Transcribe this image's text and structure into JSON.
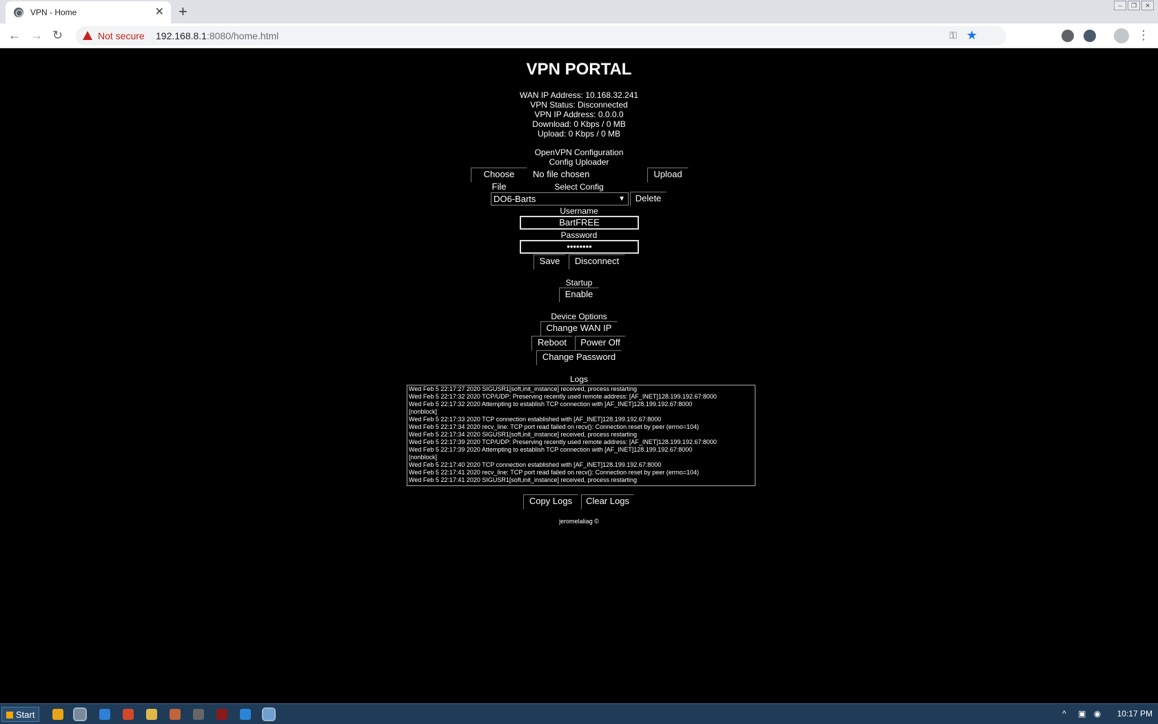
{
  "browser": {
    "tab_title": "VPN - Home",
    "tab_close": "✕",
    "new_tab": "+",
    "security_label": "Not secure",
    "url_host": "192.168.8.1",
    "url_path": ":8080/home.html",
    "back": "←",
    "forward": "→",
    "reload": "↻",
    "menu": "⋮"
  },
  "page": {
    "title": "VPN PORTAL",
    "status_lines": [
      "WAN IP Address: 10.168.32.241",
      "VPN Status: Disconnected",
      "VPN IP Address: 0.0.0.0",
      "Download: 0 Kbps / 0 MB",
      "Upload: 0 Kbps / 0 MB"
    ],
    "openvpn_heading": "OpenVPN Configuration",
    "uploader_heading": "Config Uploader",
    "choose_file_label": "Choose File",
    "no_file_text": "No file chosen",
    "upload_label": "Upload",
    "select_config_heading": "Select Config",
    "selected_config": "DO6-Barts",
    "delete_label": "Delete",
    "username_heading": "Username",
    "username_value": "BartFREE",
    "password_heading": "Password",
    "password_value": "••••••••",
    "save_label": "Save",
    "disconnect_label": "Disconnect",
    "startup_heading": "Startup",
    "enable_label": "Enable",
    "device_heading": "Device Options",
    "change_wan_label": "Change WAN IP",
    "reboot_label": "Reboot",
    "poweroff_label": "Power Off",
    "change_password_label": "Change Password",
    "logs_heading": "Logs",
    "log_lines": [
      "Wed Feb  5 22:17:27 2020 SIGUSR1[soft,init_instance] received, process restarting",
      "Wed Feb  5 22:17:32 2020 TCP/UDP: Preserving recently used remote address: [AF_INET]128.199.192.67:8000",
      "Wed Feb  5 22:17:32 2020 Attempting to establish TCP connection with [AF_INET]128.199.192.67:8000",
      "[nonblock]",
      "Wed Feb  5 22:17:33 2020 TCP connection established with [AF_INET]128.199.192.67:8000",
      "Wed Feb  5 22:17:34 2020 recv_line: TCP port read failed on recv(): Connection reset by peer (errno=104)",
      "Wed Feb  5 22:17:34 2020 SIGUSR1[soft,init_instance] received, process restarting",
      "Wed Feb  5 22:17:39 2020 TCP/UDP: Preserving recently used remote address: [AF_INET]128.199.192.67:8000",
      "Wed Feb  5 22:17:39 2020 Attempting to establish TCP connection with [AF_INET]128.199.192.67:8000",
      "[nonblock]",
      "Wed Feb  5 22:17:40 2020 TCP connection established with [AF_INET]128.199.192.67:8000",
      "Wed Feb  5 22:17:41 2020 recv_line: TCP port read failed on recv(): Connection reset by peer (errno=104)",
      "Wed Feb  5 22:17:41 2020 SIGUSR1[soft,init_instance] received, process restarting"
    ],
    "copy_logs_label": "Copy Logs",
    "clear_logs_label": "Clear Logs",
    "footer": "jeromelaliag ©"
  },
  "taskbar": {
    "start_label": "Start",
    "clock": "10:17 PM",
    "tray_up": "^"
  },
  "colors": {
    "page_bg": "#000000",
    "insecure_red": "#c5221f",
    "star_blue": "#1a73e8",
    "taskbar": "#1f3b57"
  }
}
